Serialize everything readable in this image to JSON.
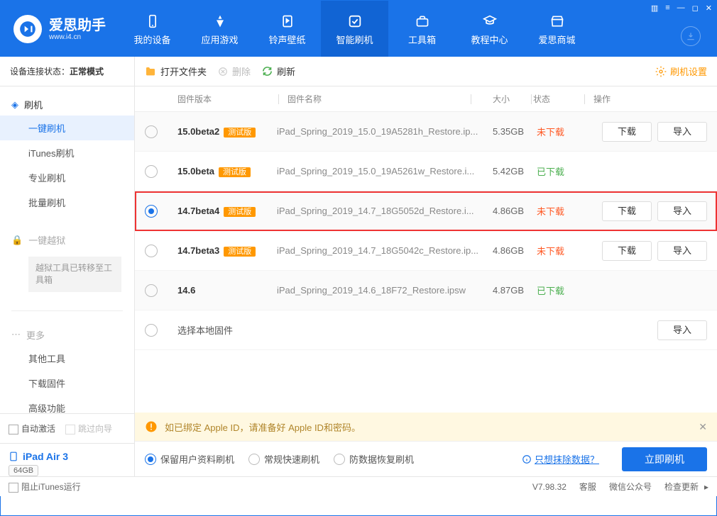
{
  "header": {
    "brand_name": "爱思助手",
    "brand_sub": "www.i4.cn",
    "nav": [
      {
        "label": "我的设备"
      },
      {
        "label": "应用游戏"
      },
      {
        "label": "铃声壁纸"
      },
      {
        "label": "智能刷机"
      },
      {
        "label": "工具箱"
      },
      {
        "label": "教程中心"
      },
      {
        "label": "爱思商城"
      }
    ]
  },
  "sidebar": {
    "status_label": "设备连接状态：",
    "status_value": "正常模式",
    "flash_head": "刷机",
    "flash_items": [
      "一键刷机",
      "iTunes刷机",
      "专业刷机",
      "批量刷机"
    ],
    "jailbreak_head": "一键越狱",
    "jailbreak_note": "越狱工具已转移至工具箱",
    "more_head": "更多",
    "more_items": [
      "其他工具",
      "下载固件",
      "高级功能"
    ],
    "auto_activate": "自动激活",
    "skip_guide": "跳过向导",
    "device_name": "iPad Air 3",
    "device_storage": "64GB",
    "device_type": "iPad"
  },
  "toolbar": {
    "open_folder": "打开文件夹",
    "delete": "删除",
    "refresh": "刷新",
    "settings": "刷机设置"
  },
  "columns": {
    "version": "固件版本",
    "name": "固件名称",
    "size": "大小",
    "status": "状态",
    "ops": "操作"
  },
  "beta_tag": "测试版",
  "btns": {
    "download": "下载",
    "import": "导入"
  },
  "status": {
    "not_downloaded": "未下载",
    "downloaded": "已下载"
  },
  "firmware": [
    {
      "version": "15.0beta2",
      "beta": true,
      "name": "iPad_Spring_2019_15.0_19A5281h_Restore.ip...",
      "size": "5.35GB",
      "status": "not",
      "ops": [
        "download",
        "import"
      ],
      "selected": false,
      "alt": true
    },
    {
      "version": "15.0beta",
      "beta": true,
      "name": "iPad_Spring_2019_15.0_19A5261w_Restore.i...",
      "size": "5.42GB",
      "status": "done",
      "ops": [],
      "selected": false,
      "alt": false
    },
    {
      "version": "14.7beta4",
      "beta": true,
      "name": "iPad_Spring_2019_14.7_18G5052d_Restore.i...",
      "size": "4.86GB",
      "status": "not",
      "ops": [
        "download",
        "import"
      ],
      "selected": true,
      "alt": true,
      "highlight": true
    },
    {
      "version": "14.7beta3",
      "beta": true,
      "name": "iPad_Spring_2019_14.7_18G5042c_Restore.ip...",
      "size": "4.86GB",
      "status": "not",
      "ops": [
        "download",
        "import"
      ],
      "selected": false,
      "alt": false
    },
    {
      "version": "14.6",
      "beta": false,
      "name": "iPad_Spring_2019_14.6_18F72_Restore.ipsw",
      "size": "4.87GB",
      "status": "done",
      "ops": [],
      "selected": false,
      "alt": true
    }
  ],
  "local_row": "选择本地固件",
  "warning": "如已绑定 Apple ID，请准备好 Apple ID和密码。",
  "options": {
    "keep_data": "保留用户资料刷机",
    "normal_fast": "常规快速刷机",
    "anti_data": "防数据恢复刷机",
    "erase_link": "只想抹除数据？",
    "flash_now": "立即刷机"
  },
  "statusbar": {
    "block_itunes": "阻止iTunes运行",
    "version": "V7.98.32",
    "service": "客服",
    "wechat": "微信公众号",
    "update": "检查更新"
  }
}
